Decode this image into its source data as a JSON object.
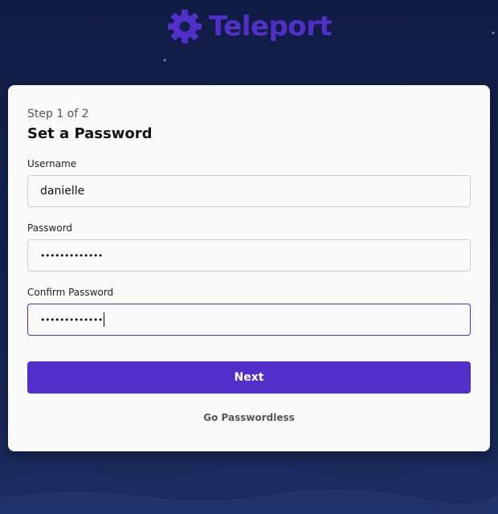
{
  "brand": {
    "name": "Teleport",
    "color": "#512fc9",
    "icon": "gear-icon"
  },
  "form": {
    "step": "Step 1 of 2",
    "title": "Set a Password",
    "username": {
      "label": "Username",
      "value": "danielle"
    },
    "password": {
      "label": "Password",
      "value": "•••••••••••••"
    },
    "confirm_password": {
      "label": "Confirm Password",
      "value": "•••••••••••••"
    },
    "next_label": "Next",
    "passwordless_label": "Go Passwordless"
  },
  "colors": {
    "background": "#13204b",
    "card": "#fafafa",
    "accent": "#512fc9"
  }
}
